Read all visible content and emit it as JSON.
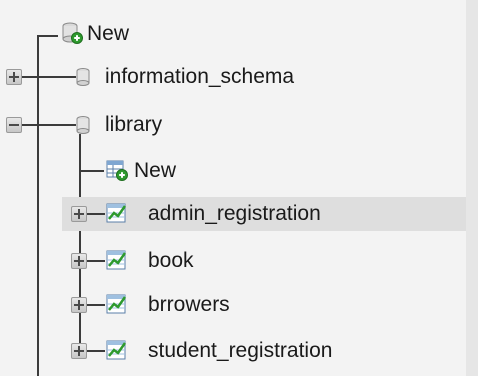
{
  "tree": {
    "root_new": {
      "label": "New"
    },
    "databases": [
      {
        "name": "information_schema",
        "expanded": false
      },
      {
        "name": "library",
        "expanded": true
      }
    ],
    "library_children": {
      "new_label": "New",
      "tables": [
        {
          "name": "admin_registration",
          "highlighted": true
        },
        {
          "name": "book",
          "highlighted": false
        },
        {
          "name": "brrowers",
          "highlighted": false
        },
        {
          "name": "student_registration",
          "highlighted": false
        }
      ]
    }
  },
  "colors": {
    "background": "#f3f3f3",
    "highlight": "#dedede",
    "tree_line": "#3b3b3b",
    "plus_green": "#2e9a2e"
  }
}
